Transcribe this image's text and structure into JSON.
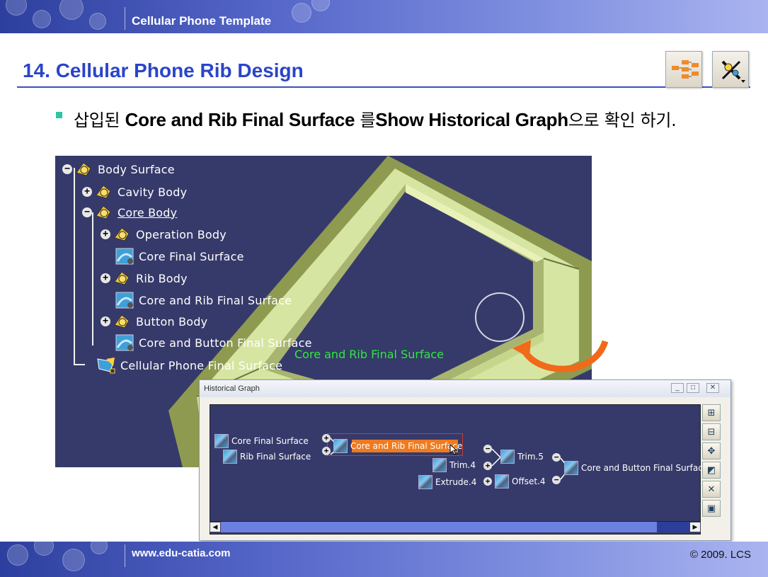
{
  "header": {
    "template_title": "Cellular Phone Template"
  },
  "slide": {
    "title": "14. Cellular Phone Rib Design",
    "bullet_prefix": "삽입된 ",
    "bullet_bold1": "Core and Rib Final Surface",
    "bullet_mid": " 를",
    "bullet_bold2": "Show Historical Graph",
    "bullet_suffix": "으로 확인 하기."
  },
  "toolbar": {
    "icons": [
      "graph-structure-icon",
      "show-historical-graph-icon"
    ]
  },
  "tree": {
    "items": [
      {
        "label": "Body Surface",
        "expander": "−"
      },
      {
        "label": "Cavity Body",
        "expander": "+"
      },
      {
        "label": "Core Body",
        "expander": "−"
      },
      {
        "label": "Operation Body",
        "expander": "+"
      },
      {
        "label": "Core Final Surface",
        "expander": ""
      },
      {
        "label": "Rib Body",
        "expander": "+"
      },
      {
        "label": "Core and Rib Final Surface",
        "expander": ""
      },
      {
        "label": "Button Body",
        "expander": "+"
      },
      {
        "label": "Core and Button Final Surface",
        "expander": ""
      },
      {
        "label": "Cellular Phone Final Surface",
        "expander": ""
      }
    ]
  },
  "viewport": {
    "overlay_label": "Core and Rib Final Surface"
  },
  "historical_graph": {
    "window_title": "Historical Graph",
    "nodes": {
      "core_final": "Core Final Surface",
      "rib_final": "Rib Final Surface",
      "core_rib_final": "Core and Rib Final Surface",
      "trim4": "Trim.4",
      "extrude4": "Extrude.4",
      "trim5": "Trim.5",
      "offset4": "Offset.4",
      "core_button_final": "Core and Button Final Surface"
    },
    "window_buttons": [
      "_",
      "□",
      "✕"
    ],
    "scroll_left": "◀",
    "scroll_right": "▶"
  },
  "footer": {
    "url": "www.edu-catia.com",
    "copyright": "© 2009. LCS"
  },
  "colors": {
    "accent_blue": "#2a45c8",
    "viewport_bg": "#363a6a",
    "selection_orange": "#f07a1e",
    "overlay_green": "#2ee83e"
  }
}
